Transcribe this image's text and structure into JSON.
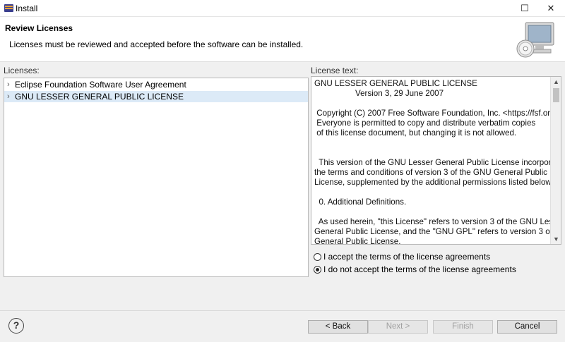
{
  "window": {
    "title": "Install",
    "minimize_glyph": "☐",
    "close_glyph": "✕"
  },
  "header": {
    "title": "Review Licenses",
    "description": "Licenses must be reviewed and accepted before the software can be installed."
  },
  "licenses": {
    "label": "Licenses:",
    "items": [
      {
        "label": "Eclipse Foundation Software User Agreement",
        "selected": false
      },
      {
        "label": "GNU LESSER GENERAL PUBLIC LICENSE",
        "selected": true
      }
    ]
  },
  "license_text": {
    "label": "License text:",
    "content": "GNU LESSER GENERAL PUBLIC LICENSE\n                  Version 3, 29 June 2007\n\n Copyright (C) 2007 Free Software Foundation, Inc. <https://fsf.org/>\n Everyone is permitted to copy and distribute verbatim copies\n of this license document, but changing it is not allowed.\n\n\n  This version of the GNU Lesser General Public License incorporates\nthe terms and conditions of version 3 of the GNU General Public\nLicense, supplemented by the additional permissions listed below.\n\n  0. Additional Definitions.\n\n  As used herein, \"this License\" refers to version 3 of the GNU Lesser\nGeneral Public License, and the \"GNU GPL\" refers to version 3 of the GNU\nGeneral Public License."
  },
  "agreement": {
    "accept_label": "I accept the terms of the license agreements",
    "decline_label": "I do not accept the terms of the license agreements",
    "selected": "decline"
  },
  "buttons": {
    "help": "?",
    "back": "< Back",
    "next": "Next >",
    "finish": "Finish",
    "cancel": "Cancel"
  },
  "icons": {
    "app": "eclipse-install-icon",
    "wizard": "computer-cd-icon"
  }
}
